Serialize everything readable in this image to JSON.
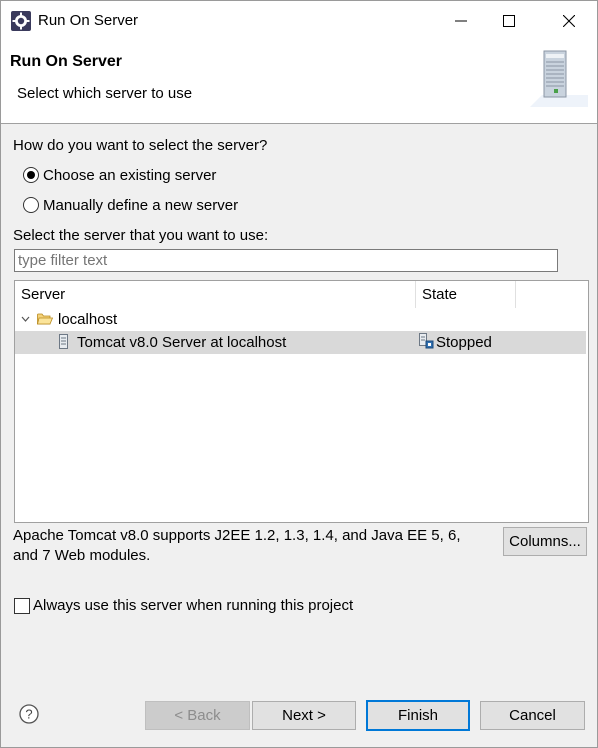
{
  "window": {
    "title": "Run On Server"
  },
  "header": {
    "title": "Run On Server",
    "subtitle": "Select which server to use",
    "icon": "server-tower-icon"
  },
  "selection": {
    "question": "How do you want to select the server?",
    "option_existing": "Choose an existing server",
    "option_new": "Manually define a new server",
    "selected": "existing"
  },
  "filter": {
    "label": "Select the server that you want to use:",
    "placeholder": "type filter text"
  },
  "table": {
    "columns": [
      "Server",
      "State"
    ],
    "group": "localhost",
    "rows": [
      {
        "server": "Tomcat v8.0 Server at localhost",
        "state": "Stopped",
        "selected": true
      }
    ]
  },
  "description": {
    "line1": "Apache Tomcat v8.0 supports J2EE 1.2, 1.3, 1.4, and Java EE 5, 6,",
    "line2": "and 7 Web modules.",
    "columns_button": "Columns..."
  },
  "always_use": {
    "label": "Always use this server when running this project",
    "checked": false
  },
  "footer": {
    "back": "< Back",
    "next": "Next >",
    "finish": "Finish",
    "cancel": "Cancel"
  },
  "colors": {
    "accent": "#0078d7",
    "selection": "#d9d9d9"
  }
}
